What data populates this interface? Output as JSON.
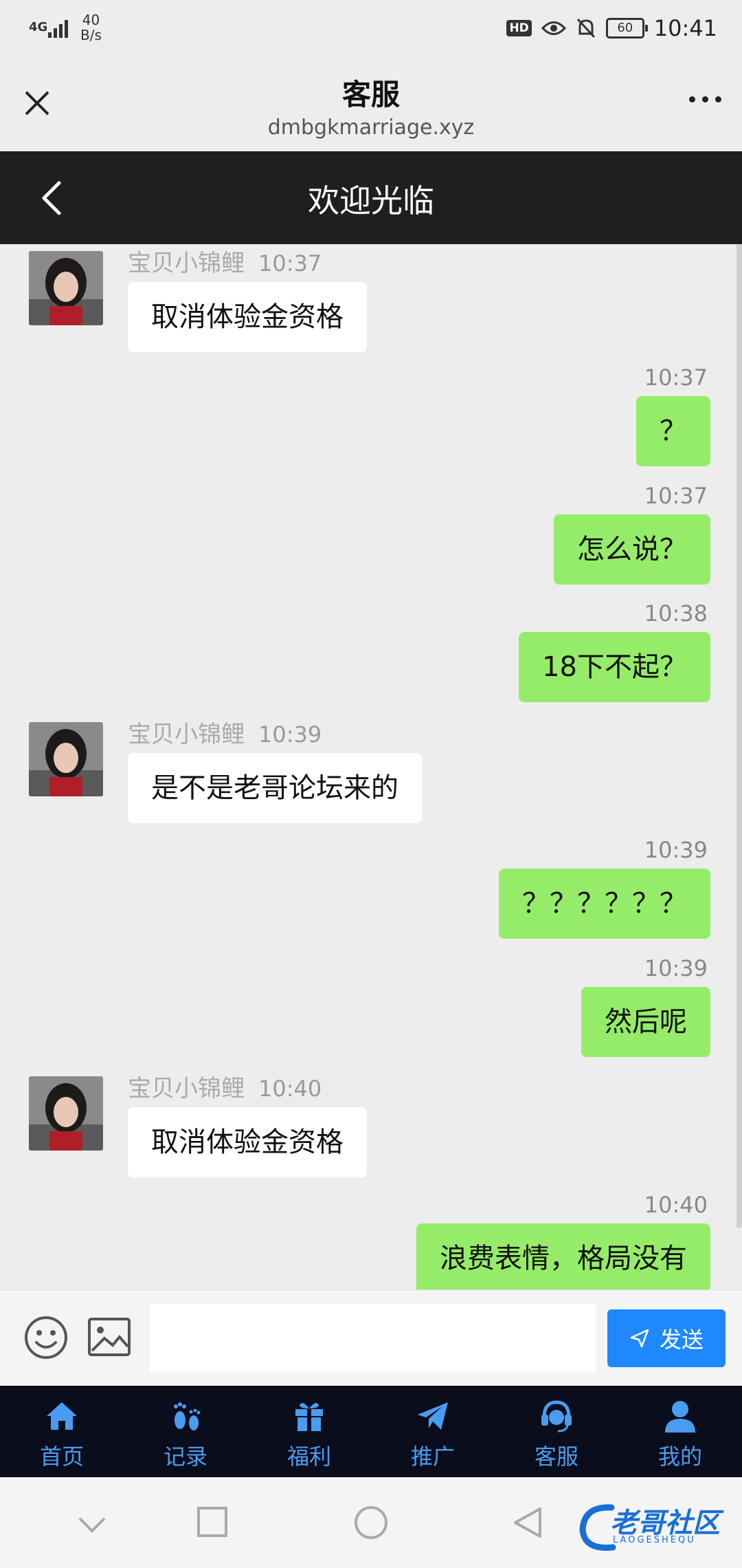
{
  "status_bar": {
    "network": "4G",
    "speed_value": "40",
    "speed_unit": "B/s",
    "hd": "HD",
    "battery": "60",
    "time": "10:41"
  },
  "browser_bar": {
    "title": "客服",
    "url": "dmbgkmarriage.xyz"
  },
  "app_header": {
    "title": "欢迎光临"
  },
  "messages": [
    {
      "side": "left",
      "sender": "宝贝小锦鲤",
      "time": "10:37",
      "text": "取消体验金资格"
    },
    {
      "side": "right",
      "time": "10:37",
      "text": "？"
    },
    {
      "side": "right",
      "time": "10:37",
      "text": "怎么说？"
    },
    {
      "side": "right",
      "time": "10:38",
      "text": "18下不起？"
    },
    {
      "side": "left",
      "sender": "宝贝小锦鲤",
      "time": "10:39",
      "text": "是不是老哥论坛来的"
    },
    {
      "side": "right",
      "time": "10:39",
      "text": "？？？？？？"
    },
    {
      "side": "right",
      "time": "10:39",
      "text": "然后呢"
    },
    {
      "side": "left",
      "sender": "宝贝小锦鲤",
      "time": "10:40",
      "text": "取消体验金资格"
    },
    {
      "side": "right",
      "time": "10:40",
      "text": "浪费表情，格局没有"
    }
  ],
  "input_bar": {
    "placeholder": "",
    "send_label": "发送",
    "send_color": "#1f88ff"
  },
  "tabs": [
    {
      "label": "首页",
      "icon": "home-icon"
    },
    {
      "label": "记录",
      "icon": "footprints-icon"
    },
    {
      "label": "福利",
      "icon": "gift-icon"
    },
    {
      "label": "推广",
      "icon": "paper-plane-icon"
    },
    {
      "label": "客服",
      "icon": "headset-icon"
    },
    {
      "label": "我的",
      "icon": "user-icon"
    }
  ],
  "watermark": {
    "text": "老哥社区",
    "sub": "LAOGESHEQU"
  },
  "colors": {
    "bubble_self": "#95ec69",
    "bubble_other": "#ffffff",
    "header_bg": "#1f1f1f",
    "tabbar_bg": "#0a0d1c",
    "tab_label": "#4a9cf0"
  }
}
